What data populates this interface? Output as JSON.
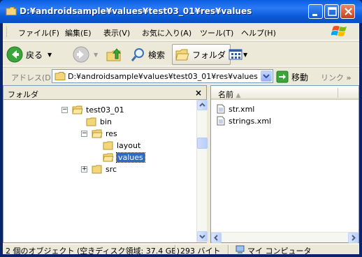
{
  "window": {
    "title": "D:¥androidsample¥values¥test03_01¥res¥values"
  },
  "menubar": {
    "items": [
      {
        "label": "ファイル(F)"
      },
      {
        "label": "編集(E)"
      },
      {
        "label": "表示(V)"
      },
      {
        "label": "お気に入り(A)"
      },
      {
        "label": "ツール(T)"
      },
      {
        "label": "ヘルプ(H)"
      }
    ]
  },
  "toolbar": {
    "back_label": "戻る",
    "search_label": "検索",
    "folders_label": "フォルダ"
  },
  "addressbar": {
    "label": "アドレス(D)",
    "value": "D:¥androidsample¥values¥test03_01¥res¥values",
    "go_label": "移動",
    "links_label": "リンク"
  },
  "folder_pane": {
    "title": "フォルダ",
    "close_glyph": "×",
    "tree": [
      {
        "label": "test03_01",
        "expander": "−"
      },
      {
        "label": "bin",
        "expander": ""
      },
      {
        "label": "res",
        "expander": "−"
      },
      {
        "label": "layout",
        "expander": ""
      },
      {
        "label": "values",
        "expander": "",
        "selected": true
      },
      {
        "label": "src",
        "expander": "+"
      }
    ]
  },
  "file_pane": {
    "column_name": "名前",
    "files": [
      {
        "label": "str.xml"
      },
      {
        "label": "strings.xml"
      }
    ]
  },
  "statusbar": {
    "objects": "2 個のオブジェクト (空きディスク領域: 37.4 GB)",
    "size": "293 バイト",
    "location": "マイ コンピュータ"
  },
  "colors": {
    "titlebar": "#0A5FE0",
    "chrome": "#ECE9D8",
    "selection": "#316AC5",
    "folder": "#F3D67A"
  }
}
